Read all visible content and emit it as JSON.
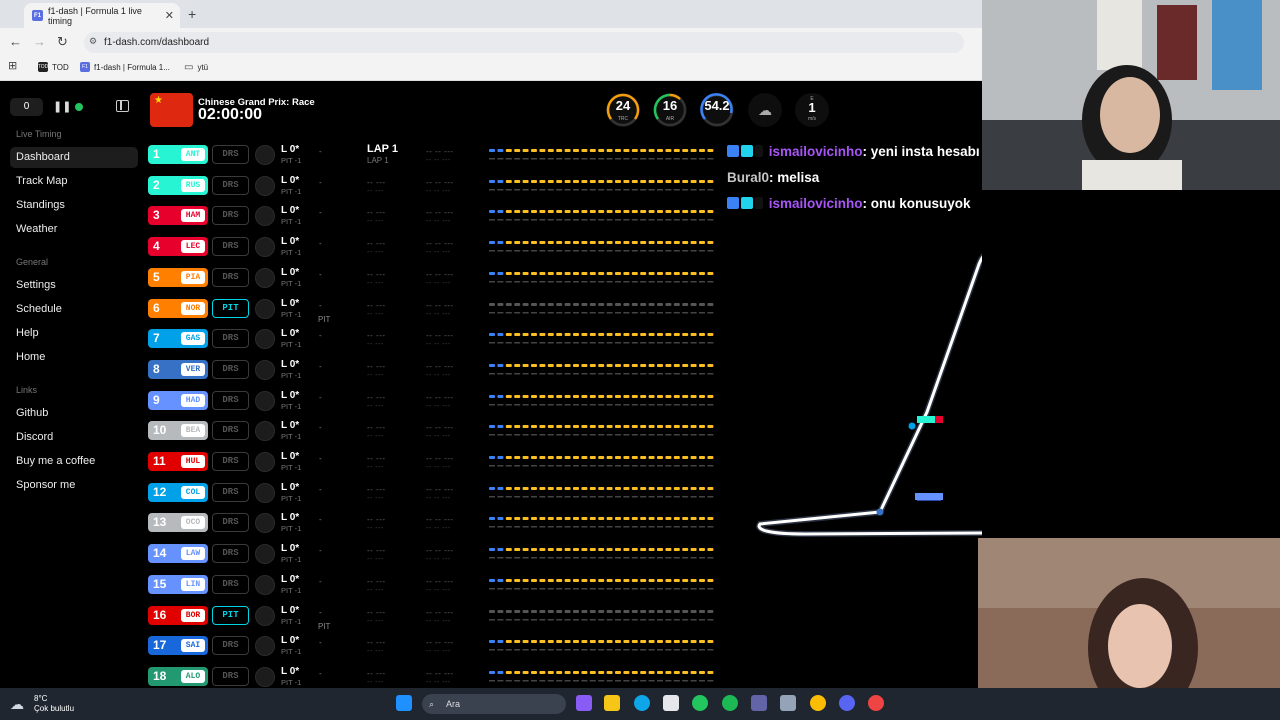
{
  "browser": {
    "tab_title": "f1-dash | Formula 1 live timing",
    "favicon_text": "F1",
    "url": "f1-dash.com/dashboard",
    "bookmarks": [
      {
        "label": "TOD",
        "icon": "TOD"
      },
      {
        "label": "f1-dash | Formula 1...",
        "icon": "F1"
      },
      {
        "label": "ytü",
        "icon": "folder-icon"
      }
    ]
  },
  "sidebar": {
    "delay": "0",
    "sections": [
      {
        "title": "Live Timing",
        "items": [
          "Dashboard",
          "Track Map",
          "Standings",
          "Weather"
        ]
      },
      {
        "title": "General",
        "items": [
          "Settings",
          "Schedule",
          "Help",
          "Home"
        ]
      },
      {
        "title": "Links",
        "items": [
          "Github",
          "Discord",
          "Buy me a coffee",
          "Sponsor me"
        ]
      }
    ],
    "active_item": "Dashboard"
  },
  "session": {
    "name": "Chinese Grand Prix: Race",
    "clock": "02:00:00",
    "lap_label": "LAP 1",
    "lap_sub": "LAP 1"
  },
  "weather": {
    "track": {
      "value": "24",
      "label": "TRC",
      "color": "#f59e0b"
    },
    "air": {
      "value": "16",
      "label": "AIR",
      "color": "#22c55e"
    },
    "humidity": {
      "value": "54.2",
      "color": "#3b82f6"
    },
    "rain_icon": "cloud-rain-icon",
    "wind": {
      "value": "1",
      "unit": "m/s",
      "dir": "E"
    }
  },
  "drivers": [
    {
      "pos": "1",
      "tla": "ANT",
      "color": "#27f4d2",
      "pit": false
    },
    {
      "pos": "2",
      "tla": "RUS",
      "color": "#27f4d2",
      "pit": false
    },
    {
      "pos": "3",
      "tla": "HAM",
      "color": "#e8002d",
      "pit": false
    },
    {
      "pos": "4",
      "tla": "LEC",
      "color": "#e8002d",
      "pit": false
    },
    {
      "pos": "5",
      "tla": "PIA",
      "color": "#ff8000",
      "pit": false
    },
    {
      "pos": "6",
      "tla": "NOR",
      "color": "#ff8000",
      "pit": true
    },
    {
      "pos": "7",
      "tla": "GAS",
      "color": "#00a1e8",
      "pit": false
    },
    {
      "pos": "8",
      "tla": "VER",
      "color": "#3671c6",
      "pit": false
    },
    {
      "pos": "9",
      "tla": "HAD",
      "color": "#6692ff",
      "pit": false
    },
    {
      "pos": "10",
      "tla": "BEA",
      "color": "#b6babd",
      "pit": false
    },
    {
      "pos": "11",
      "tla": "HUL",
      "color": "#e00000",
      "pit": false
    },
    {
      "pos": "12",
      "tla": "COL",
      "color": "#00a1e8",
      "pit": false
    },
    {
      "pos": "13",
      "tla": "OCO",
      "color": "#b6babd",
      "pit": false
    },
    {
      "pos": "14",
      "tla": "LAW",
      "color": "#6692ff",
      "pit": false
    },
    {
      "pos": "15",
      "tla": "LIN",
      "color": "#6692ff",
      "pit": false
    },
    {
      "pos": "16",
      "tla": "BOR",
      "color": "#e00000",
      "pit": true
    },
    {
      "pos": "17",
      "tla": "SAI",
      "color": "#1868db",
      "pit": false
    },
    {
      "pos": "18",
      "tla": "ALO",
      "color": "#229971",
      "pit": false
    }
  ],
  "row_text": {
    "drs": "DRS",
    "pit": "PIT",
    "lap_pos": "L 0*",
    "pit_count": "PIT -1",
    "gap": "-",
    "time_placeholder": "-- ---",
    "sector_placeholder": "-- -- ---",
    "pit_label": "PIT"
  },
  "chat": [
    {
      "user": "ismailovicinho",
      "text": ": yeni insta hesabı açtık",
      "badges": true
    },
    {
      "user": "Bural0",
      "text": ": melisa",
      "badges": false
    },
    {
      "user": "ismailovicinho",
      "text": ": onu konusuyok",
      "badges": true
    }
  ],
  "taskbar": {
    "temp": "8°C",
    "condition": "Çok bulutlu",
    "search_placeholder": "Ara"
  }
}
